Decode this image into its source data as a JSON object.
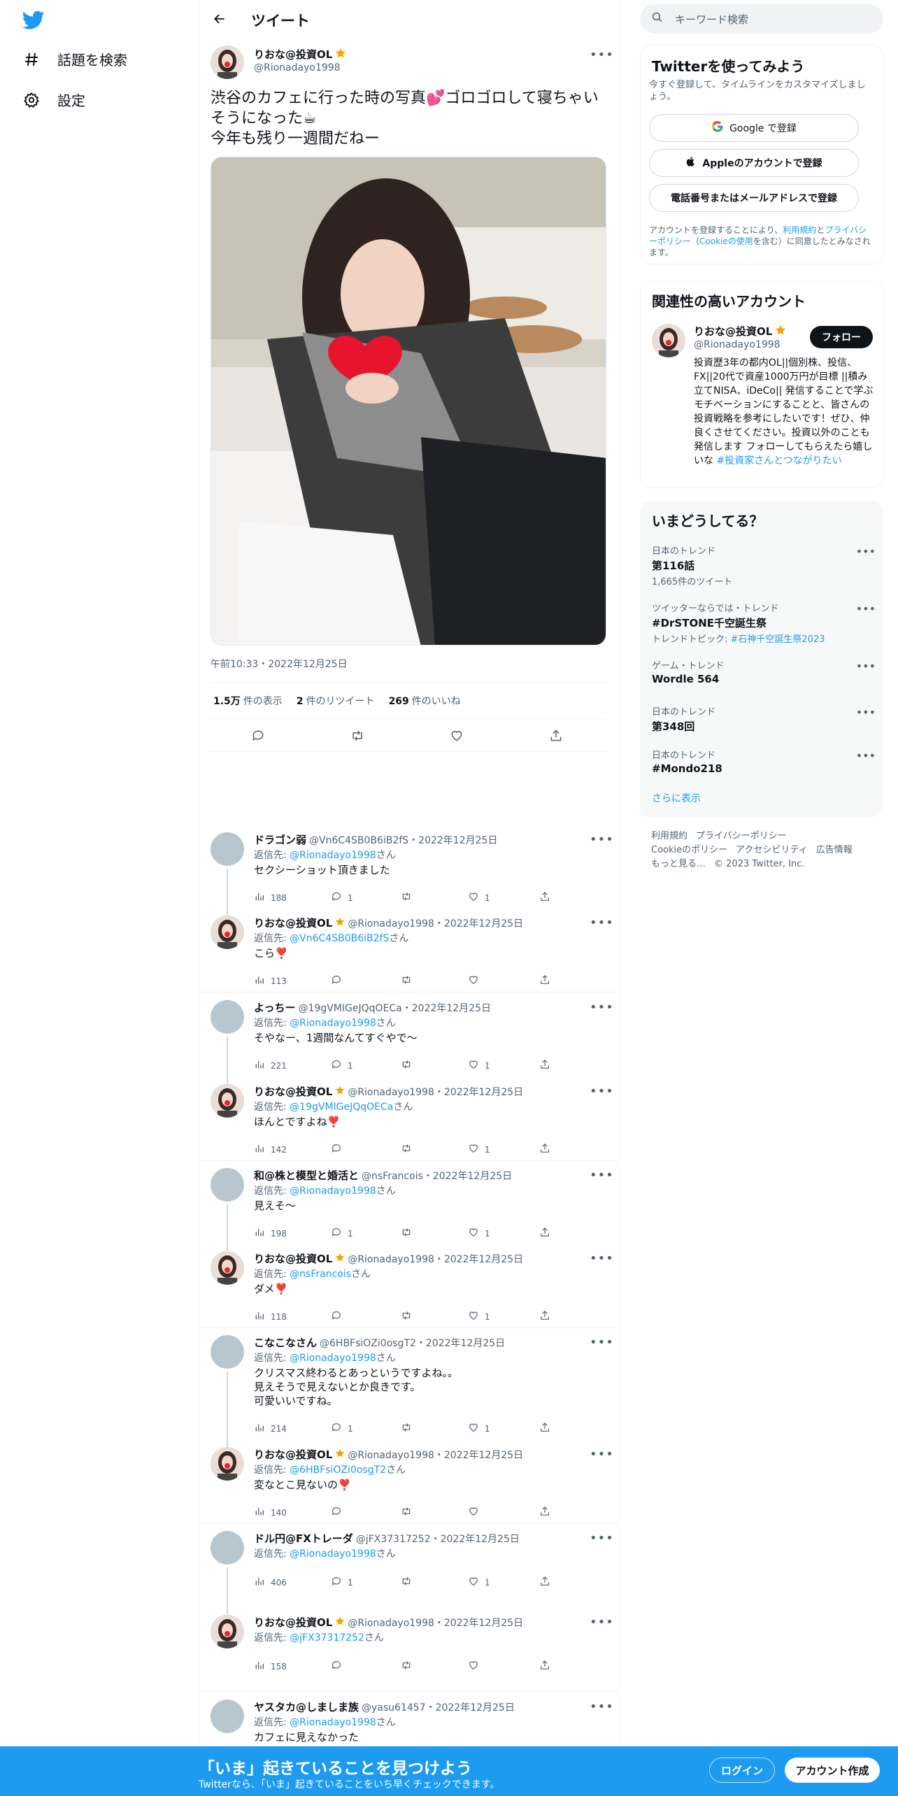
{
  "nav": {
    "explore_label": "話題を検索",
    "settings_label": "設定"
  },
  "header": {
    "title": "ツイート"
  },
  "tweet": {
    "name": "りおな@投資OL",
    "handle": "@Rionadayo1998",
    "text": "渋谷のカフェに行った時の写真💕ゴロゴロして寝ちゃいそうになった☕\n今年も残り一週間だねー",
    "time": "午前10:33・2022年12月25日",
    "views_count": "1.5万",
    "views_label": "件の表示",
    "retweets_count": "2",
    "retweets_label": "件のリツイート",
    "likes_count": "269",
    "likes_label": "件のいいね"
  },
  "replies": [
    {
      "name": "ドラゴン弱",
      "handle": "@Vn6C4SB0B6iB2fS・2022年12月25日",
      "reply_prefix": "返信先: ",
      "reply_to": "@Rionadayo1998",
      "reply_suffix": "さん",
      "text": "セクシーショット頂きました",
      "views": "188",
      "comments": "1",
      "retweets": "",
      "likes": "1"
    },
    {
      "name": "りおな@投資OL",
      "handle": "@Rionadayo1998・2022年12月25日",
      "reply_prefix": "返信先: ",
      "reply_to": "@Vn6C4SB0B6iB2fS",
      "reply_suffix": "さん",
      "text": "こら❣️",
      "views": "113",
      "comments": "",
      "retweets": "",
      "likes": ""
    },
    {
      "name": "よっちー",
      "handle": "@19gVMIGeJQqOECa・2022年12月25日",
      "reply_prefix": "返信先: ",
      "reply_to": "@Rionadayo1998",
      "reply_suffix": "さん",
      "text": "そやなー、1週間なんてすぐやで〜",
      "views": "221",
      "comments": "1",
      "retweets": "",
      "likes": "1"
    },
    {
      "name": "りおな@投資OL",
      "handle": "@Rionadayo1998・2022年12月25日",
      "reply_prefix": "返信先: ",
      "reply_to": "@19gVMIGeJQqOECa",
      "reply_suffix": "さん",
      "text": "ほんとですよね❣️",
      "views": "142",
      "comments": "",
      "retweets": "",
      "likes": "1"
    },
    {
      "name": "和@株と模型と婚活と",
      "handle": "@nsFrancois・2022年12月25日",
      "reply_prefix": "返信先: ",
      "reply_to": "@Rionadayo1998",
      "reply_suffix": "さん",
      "text": "見えそ〜",
      "views": "198",
      "comments": "1",
      "retweets": "",
      "likes": "1"
    },
    {
      "name": "りおな@投資OL",
      "handle": "@Rionadayo1998・2022年12月25日",
      "reply_prefix": "返信先: ",
      "reply_to": "@nsFrancois",
      "reply_suffix": "さん",
      "text": "ダメ❣️",
      "views": "118",
      "comments": "",
      "retweets": "",
      "likes": "1"
    },
    {
      "name": "こなこなさん",
      "handle": "@6HBFsiOZi0osgT2・2022年12月25日",
      "reply_prefix": "返信先: ",
      "reply_to": "@Rionadayo1998",
      "reply_suffix": "さん",
      "text": "クリスマス終わるとあっというですよね。。\n見えそうで見えないとか良きです。\n可愛いいですね。",
      "views": "214",
      "comments": "1",
      "retweets": "",
      "likes": "1"
    },
    {
      "name": "りおな@投資OL",
      "handle": "@Rionadayo1998・2022年12月25日",
      "reply_prefix": "返信先: ",
      "reply_to": "@6HBFsiOZi0osgT2",
      "reply_suffix": "さん",
      "text": "変なとこ見ないの❣️",
      "views": "140",
      "comments": "",
      "retweets": "",
      "likes": ""
    },
    {
      "name": "ドル円@FXトレーダ",
      "handle": "@jFX37317252・2022年12月25日",
      "reply_prefix": "返信先: ",
      "reply_to": "@Rionadayo1998",
      "reply_suffix": "さん",
      "text": "",
      "views": "406",
      "comments": "1",
      "retweets": "",
      "likes": "1"
    },
    {
      "name": "りおな@投資OL",
      "handle": "@Rionadayo1998・2022年12月25日",
      "reply_prefix": "返信先: ",
      "reply_to": "@jFX37317252",
      "reply_suffix": "さん",
      "text": "",
      "views": "158",
      "comments": "",
      "retweets": "",
      "likes": ""
    },
    {
      "name": "ヤスタカ@しましま族",
      "handle": "@yasu61457・2022年12月25日",
      "reply_prefix": "返信先: ",
      "reply_to": "@Rionadayo1998",
      "reply_suffix": "さん",
      "text": "カフェに見えなかった",
      "views": "",
      "comments": "",
      "retweets": "",
      "likes": ""
    }
  ],
  "search": {
    "placeholder": "キーワード検索"
  },
  "signup_card": {
    "title": "Twitterを使ってみよう",
    "desc": "今すぐ登録して、タイムラインをカスタマイズしましょう。",
    "google_label": "Google で登録",
    "apple_label": "Appleのアカウントで登録",
    "phone_label": "電話番号またはメールアドレスで登録",
    "terms_prefix": "アカウントを登録することにより、",
    "terms_link": "利用規約",
    "terms_and": "と",
    "privacy_link": "プライバシーポリシー",
    "cookie_prefix": "（",
    "cookie_link": "Cookieの使用",
    "terms_suffix": "を含む）に同意したとみなされます。"
  },
  "related_card": {
    "title": "関連性の高いアカウント",
    "name": "りおな@投資OL",
    "handle": "@Rionadayo1998",
    "follow_label": "フォロー",
    "bio": "投資歴3年の都内OL||個別株、投信、FX||20代で資産1000万円が目標 ||積み立てNISA、iDeCo|| 発信することで学ぶモチベーションにすることと、皆さんの投資戦略を参考にしたいです！ぜひ、仲良くさせてください。投資以外のことも発信します フォローしてもらえたら嬉しいな ",
    "bio_tag": "#投資家さんとつながりたい"
  },
  "trends_card": {
    "title": "いまどうしてる？",
    "items": [
      {
        "context": "日本のトレンド",
        "name": "第116話",
        "sub": "1,665件のツイート",
        "sub_link": ""
      },
      {
        "context": "ツイッターならでは・トレンド",
        "name": "#DrSTONE千空誕生祭",
        "sub": "トレンドトピック: ",
        "sub_link": "#石神千空誕生祭2023"
      },
      {
        "context": "ゲーム・トレンド",
        "name": "Wordle 564",
        "sub": "",
        "sub_link": ""
      },
      {
        "context": "日本のトレンド",
        "name": "第348回",
        "sub": "",
        "sub_link": ""
      },
      {
        "context": "日本のトレンド",
        "name": "#Mondo218",
        "sub": "",
        "sub_link": ""
      }
    ],
    "show_more": "さらに表示"
  },
  "footer": {
    "terms": "利用規約",
    "privacy": "プライバシーポリシー",
    "cookie": "Cookieのポリシー",
    "accessibility": "アクセシビリティ",
    "ads": "広告情報",
    "more": "もっと見る…",
    "copyright": "© 2023 Twitter, Inc."
  },
  "banner": {
    "title": "「いま」起きていることを見つけよう",
    "subtitle": "Twitterなら、「いま」起きていることをいち早くチェックできます。",
    "login_label": "ログイン",
    "signup_label": "アカウント作成"
  },
  "colors": {
    "brand": "#1d9bf0",
    "text": "#0f1419",
    "muted": "#536471",
    "heart": "#f91880",
    "verified": "#f4a300"
  }
}
